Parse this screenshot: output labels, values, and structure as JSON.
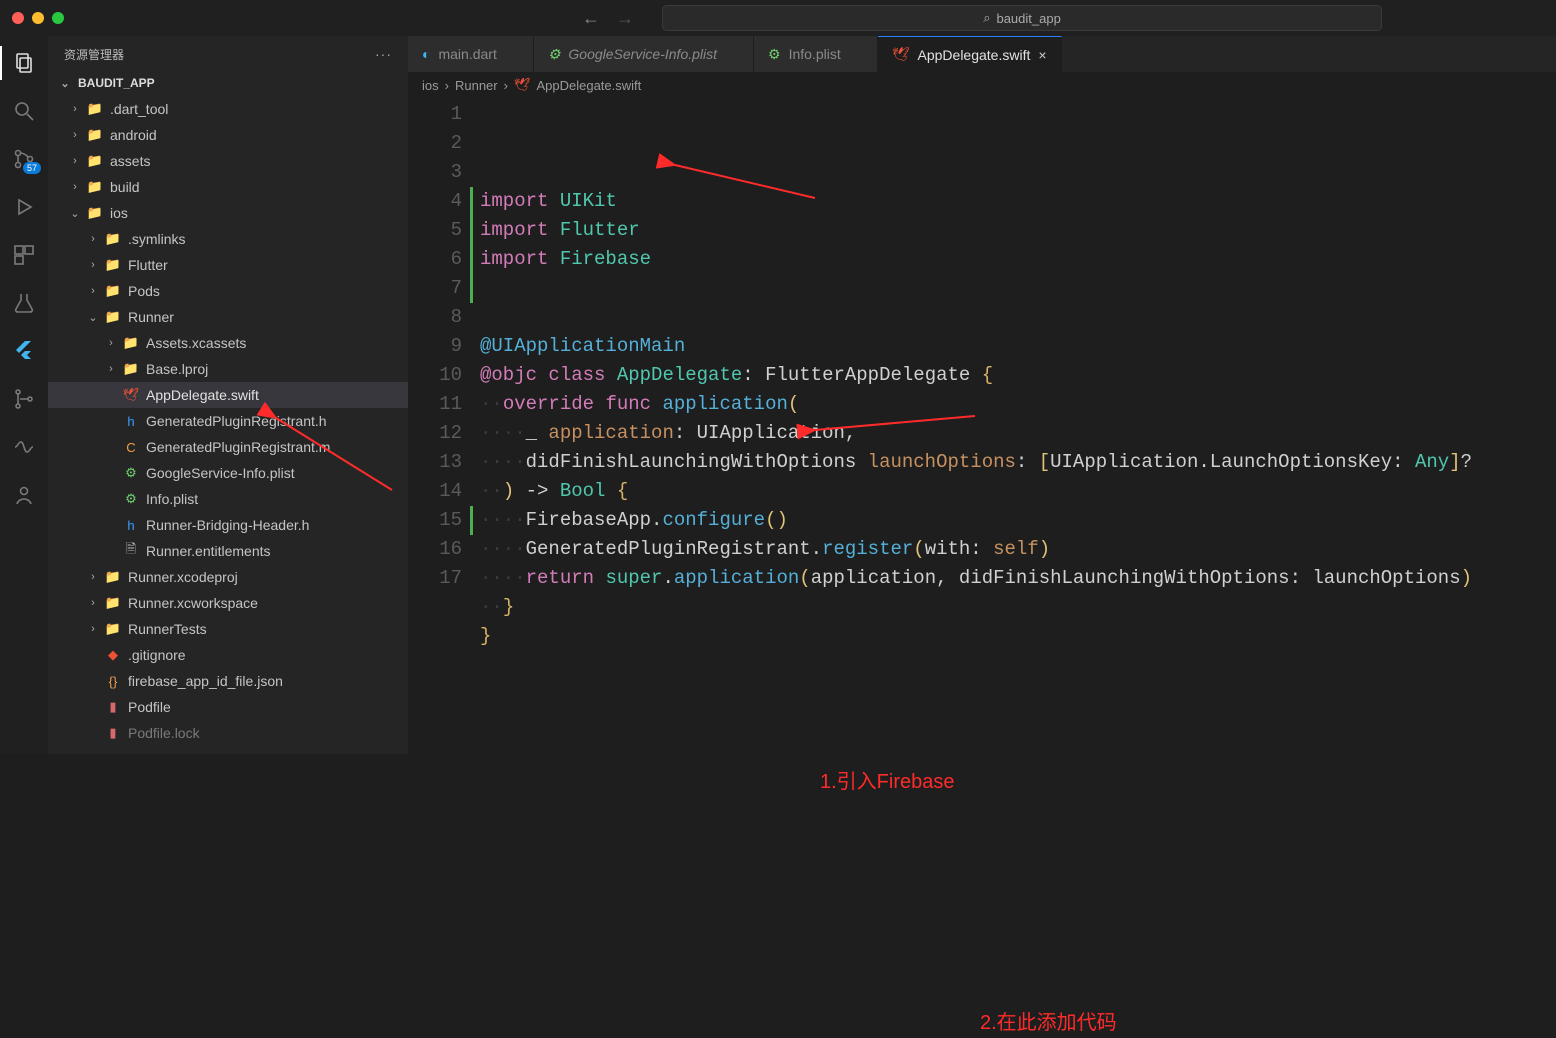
{
  "title_search": "baudit_app",
  "explorer_title": "资源管理器",
  "project_name": "BAUDIT_APP",
  "scm_badge": "57",
  "tree": [
    {
      "depth": 0,
      "chev": "›",
      "icon": "📁",
      "name": ".dart_tool",
      "color": "#c5c5c5",
      "ic": "#bfbfbf"
    },
    {
      "depth": 0,
      "chev": "›",
      "icon": "📁",
      "name": "android",
      "color": "#c5c5c5",
      "ic": "#7bcb6e"
    },
    {
      "depth": 0,
      "chev": "›",
      "icon": "📁",
      "name": "assets",
      "color": "#c5c5c5",
      "ic": "#d6b36a"
    },
    {
      "depth": 0,
      "chev": "›",
      "icon": "📁",
      "name": "build",
      "color": "#c5c5c5",
      "ic": "#d6786a"
    },
    {
      "depth": 0,
      "chev": "⌄",
      "icon": "📁",
      "name": "ios",
      "color": "#c5c5c5",
      "ic": "#6aa5d6"
    },
    {
      "depth": 1,
      "chev": "›",
      "icon": "📁",
      "name": ".symlinks",
      "color": "#c5c5c5",
      "ic": "#bfbfbf"
    },
    {
      "depth": 1,
      "chev": "›",
      "icon": "📁",
      "name": "Flutter",
      "color": "#c5c5c5",
      "ic": "#bfbfbf"
    },
    {
      "depth": 1,
      "chev": "›",
      "icon": "📁",
      "name": "Pods",
      "color": "#c5c5c5",
      "ic": "#bfbfbf"
    },
    {
      "depth": 1,
      "chev": "⌄",
      "icon": "📁",
      "name": "Runner",
      "color": "#c5c5c5",
      "ic": "#bfbfbf"
    },
    {
      "depth": 2,
      "chev": "›",
      "icon": "📁",
      "name": "Assets.xcassets",
      "color": "#c5c5c5",
      "ic": "#bfbfbf"
    },
    {
      "depth": 2,
      "chev": "›",
      "icon": "📁",
      "name": "Base.lproj",
      "color": "#c5c5c5",
      "ic": "#bfbfbf"
    },
    {
      "depth": 2,
      "chev": "",
      "icon": "🕊",
      "name": "AppDelegate.swift",
      "color": "#e2e2e2",
      "sel": true,
      "ic": "#f15138"
    },
    {
      "depth": 2,
      "chev": "",
      "icon": "h",
      "name": "GeneratedPluginRegistrant.h",
      "color": "#c5c5c5",
      "ic": "#3b9cff"
    },
    {
      "depth": 2,
      "chev": "",
      "icon": "C",
      "name": "GeneratedPluginRegistrant.m",
      "color": "#c5c5c5",
      "ic": "#f59e42"
    },
    {
      "depth": 2,
      "chev": "",
      "icon": "⚙",
      "name": "GoogleService-Info.plist",
      "color": "#c5c5c5",
      "ic": "#6fcf6f"
    },
    {
      "depth": 2,
      "chev": "",
      "icon": "⚙",
      "name": "Info.plist",
      "color": "#c5c5c5",
      "ic": "#6fcf6f"
    },
    {
      "depth": 2,
      "chev": "",
      "icon": "h",
      "name": "Runner-Bridging-Header.h",
      "color": "#c5c5c5",
      "ic": "#3b9cff"
    },
    {
      "depth": 2,
      "chev": "",
      "icon": "🗎",
      "name": "Runner.entitlements",
      "color": "#c5c5c5",
      "ic": "#bfbfbf"
    },
    {
      "depth": 1,
      "chev": "›",
      "icon": "📁",
      "name": "Runner.xcodeproj",
      "color": "#c5c5c5",
      "ic": "#bfbfbf"
    },
    {
      "depth": 1,
      "chev": "›",
      "icon": "📁",
      "name": "Runner.xcworkspace",
      "color": "#c5c5c5",
      "ic": "#bfbfbf"
    },
    {
      "depth": 1,
      "chev": "›",
      "icon": "📁",
      "name": "RunnerTests",
      "color": "#c5c5c5",
      "ic": "#bfbfbf"
    },
    {
      "depth": 1,
      "chev": "",
      "icon": "◆",
      "name": ".gitignore",
      "color": "#c5c5c5",
      "ic": "#f05033"
    },
    {
      "depth": 1,
      "chev": "",
      "icon": "{}",
      "name": "firebase_app_id_file.json",
      "color": "#c5c5c5",
      "ic": "#f0a050"
    },
    {
      "depth": 1,
      "chev": "",
      "icon": "▮",
      "name": "Podfile",
      "color": "#c5c5c5",
      "ic": "#d66a6a"
    },
    {
      "depth": 1,
      "chev": "",
      "icon": "▮",
      "name": "Podfile.lock",
      "color": "#7a7a7a",
      "ic": "#d66a6a"
    }
  ],
  "tabs": [
    {
      "icon": "◐",
      "label": "main.dart",
      "iconColor": "#3fb6f2",
      "active": false,
      "italic": false,
      "close": false
    },
    {
      "icon": "⚙",
      "label": "GoogleService-Info.plist",
      "iconColor": "#6fcf6f",
      "active": false,
      "italic": true,
      "close": false
    },
    {
      "icon": "⚙",
      "label": "Info.plist",
      "iconColor": "#6fcf6f",
      "active": false,
      "italic": false,
      "close": false
    },
    {
      "icon": "🕊",
      "label": "AppDelegate.swift",
      "iconColor": "#f15138",
      "active": true,
      "italic": false,
      "close": true
    }
  ],
  "breadcrumb": [
    "ios",
    "Runner",
    "AppDelegate.swift"
  ],
  "code": [
    {
      "n": 1,
      "g": true,
      "seg": [
        [
          "kw",
          "import "
        ],
        [
          "tp",
          "UIKit"
        ]
      ]
    },
    {
      "n": 2,
      "g": true,
      "seg": [
        [
          "kw",
          "import "
        ],
        [
          "tp",
          "Flutter"
        ]
      ]
    },
    {
      "n": 3,
      "g": true,
      "seg": [
        [
          "kw",
          "import "
        ],
        [
          "tp",
          "Firebase"
        ]
      ]
    },
    {
      "n": 4,
      "g": true,
      "seg": []
    },
    {
      "n": 5,
      "g": false,
      "seg": []
    },
    {
      "n": 6,
      "g": false,
      "seg": [
        [
          "fn",
          "@UIApplicationMain"
        ]
      ]
    },
    {
      "n": 7,
      "g": false,
      "seg": [
        [
          "kw",
          "@objc "
        ],
        [
          "kw",
          "class "
        ],
        [
          "tp",
          "AppDelegate"
        ],
        [
          "nm",
          ": FlutterAppDelegate "
        ],
        [
          "bk",
          "{"
        ]
      ]
    },
    {
      "n": 8,
      "g": false,
      "seg": [
        [
          "ws",
          "··"
        ],
        [
          "kw",
          "override "
        ],
        [
          "kw",
          "func "
        ],
        [
          "fn",
          "application"
        ],
        [
          "pn",
          "("
        ]
      ]
    },
    {
      "n": 9,
      "g": false,
      "seg": [
        [
          "ws",
          "····"
        ],
        [
          "nm",
          "_ "
        ],
        [
          "st",
          "application"
        ],
        [
          "nm",
          ": UIApplication,"
        ]
      ]
    },
    {
      "n": 10,
      "g": false,
      "seg": [
        [
          "ws",
          "····"
        ],
        [
          "nm",
          "didFinishLaunchingWithOptions "
        ],
        [
          "st",
          "launchOptions"
        ],
        [
          "nm",
          ": "
        ],
        [
          "pn",
          "["
        ],
        [
          "nm",
          "UIApplication.LaunchOptionsKey: "
        ],
        [
          "tp",
          "Any"
        ],
        [
          "pn",
          "]"
        ],
        [
          "nm",
          "?"
        ]
      ]
    },
    {
      "n": 11,
      "g": false,
      "seg": [
        [
          "ws",
          "··"
        ],
        [
          "pn",
          ")"
        ],
        [
          "nm",
          " -> "
        ],
        [
          "tp",
          "Bool"
        ],
        [
          "nm",
          " "
        ],
        [
          "bk",
          "{"
        ]
      ]
    },
    {
      "n": 12,
      "g": true,
      "seg": [
        [
          "ws",
          "····"
        ],
        [
          "nm",
          "FirebaseApp."
        ],
        [
          "fn",
          "configure"
        ],
        [
          "pn",
          "()"
        ]
      ]
    },
    {
      "n": 13,
      "g": false,
      "seg": [
        [
          "ws",
          "····"
        ],
        [
          "nm",
          "GeneratedPluginRegistrant."
        ],
        [
          "fn",
          "register"
        ],
        [
          "pn",
          "("
        ],
        [
          "nm",
          "with: "
        ],
        [
          "st",
          "self"
        ],
        [
          "pn",
          ")"
        ]
      ]
    },
    {
      "n": 14,
      "g": false,
      "seg": [
        [
          "ws",
          "····"
        ],
        [
          "kw",
          "return "
        ],
        [
          "tp",
          "super"
        ],
        [
          "nm",
          "."
        ],
        [
          "fn",
          "application"
        ],
        [
          "pn",
          "("
        ],
        [
          "nm",
          "application, didFinishLaunchingWithOptions: launchOptions"
        ],
        [
          "pn",
          ")"
        ]
      ]
    },
    {
      "n": 15,
      "g": false,
      "seg": [
        [
          "ws",
          "··"
        ],
        [
          "bk",
          "}"
        ]
      ]
    },
    {
      "n": 16,
      "g": false,
      "seg": [
        [
          "bk",
          "}"
        ]
      ]
    },
    {
      "n": 17,
      "g": false,
      "seg": []
    }
  ],
  "annotations": {
    "a1": "1.引入Firebase",
    "a2": "2.在此添加代码"
  }
}
